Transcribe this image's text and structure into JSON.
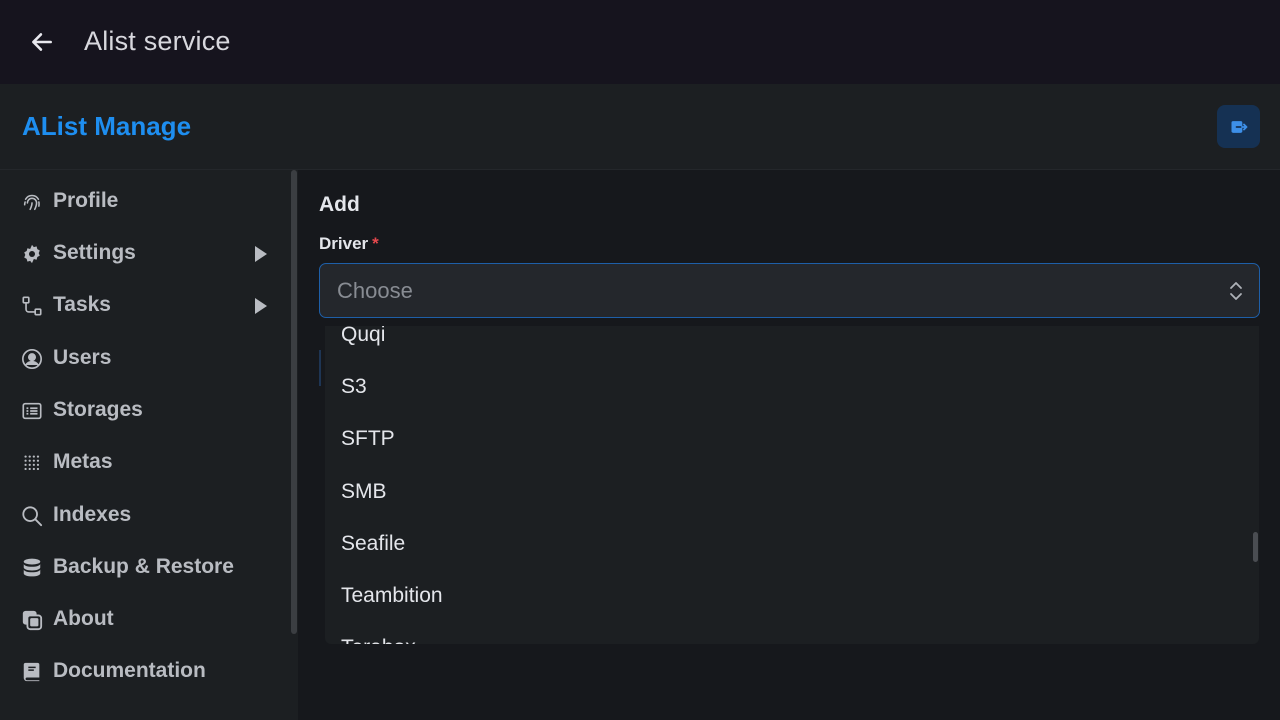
{
  "appbar": {
    "title": "Alist service",
    "back_icon": "arrow-left-icon"
  },
  "header": {
    "brand": "AList Manage",
    "logout_icon": "logout-icon",
    "accent": "#1e8ef0"
  },
  "sidebar": {
    "items": [
      {
        "label": "Profile",
        "icon": "fingerprint-icon"
      },
      {
        "label": "Settings",
        "icon": "gear-icon",
        "expandable": true
      },
      {
        "label": "Tasks",
        "icon": "workflow-icon",
        "expandable": true
      },
      {
        "label": "Users",
        "icon": "user-circle-icon"
      },
      {
        "label": "Storages",
        "icon": "storage-list-icon"
      },
      {
        "label": "Metas",
        "icon": "metas-grid-icon"
      },
      {
        "label": "Indexes",
        "icon": "search-icon"
      },
      {
        "label": "Backup & Restore",
        "icon": "database-icon"
      },
      {
        "label": "About",
        "icon": "about-copy-icon"
      },
      {
        "label": "Documentation",
        "icon": "book-icon"
      }
    ]
  },
  "form": {
    "title": "Add",
    "driver_label": "Driver",
    "required_mark": "*",
    "select_placeholder": "Choose"
  },
  "dropdown": {
    "options": [
      "Quqi",
      "S3",
      "SFTP",
      "SMB",
      "Seafile",
      "Teambition",
      "Terabox"
    ]
  }
}
